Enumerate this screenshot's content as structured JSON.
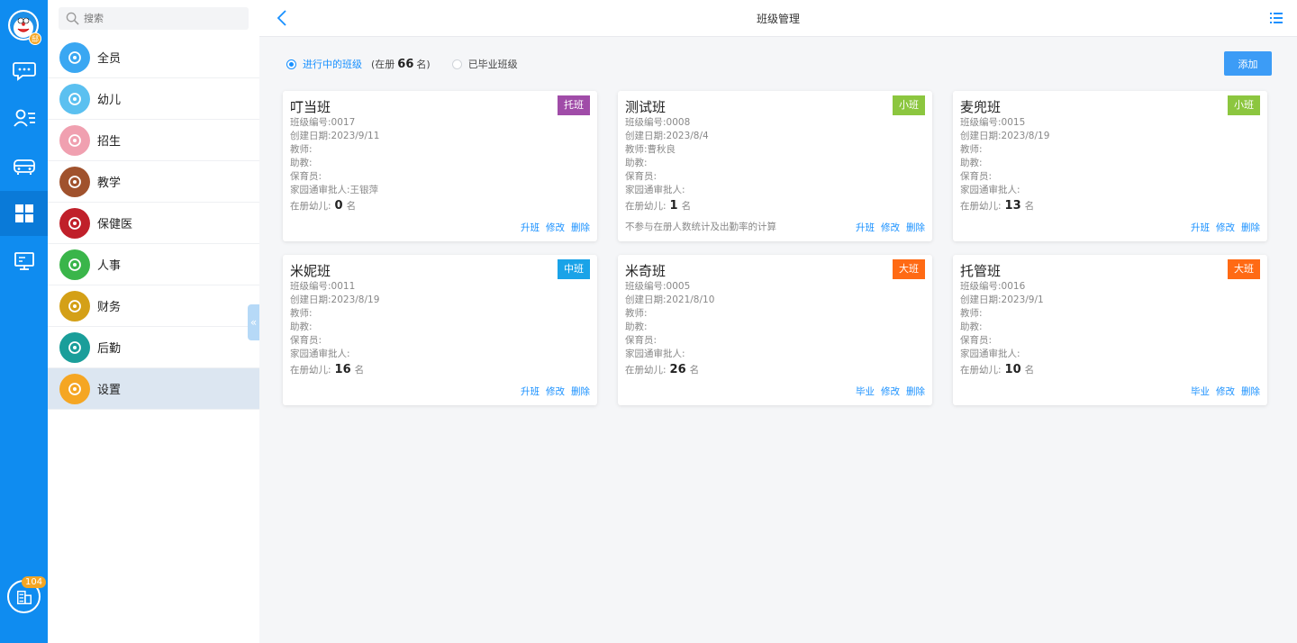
{
  "rail": {
    "avatar_badge": "邸",
    "bottom_badge": "104",
    "icons": [
      "chat-icon",
      "contacts-icon",
      "bus-icon",
      "grid-icon",
      "monitor-icon"
    ]
  },
  "search": {
    "placeholder": "搜索"
  },
  "menu": [
    {
      "label": "全员",
      "icon": "atom-icon",
      "color": "#3aa7f2"
    },
    {
      "label": "幼儿",
      "icon": "smile-icon",
      "color": "#5bc0f0"
    },
    {
      "label": "招生",
      "icon": "id-card-icon",
      "color": "#f0a0b0"
    },
    {
      "label": "教学",
      "icon": "teacher-icon",
      "color": "#a0522d"
    },
    {
      "label": "保健医",
      "icon": "heart-plus-icon",
      "color": "#c0202a"
    },
    {
      "label": "人事",
      "icon": "hr-icon",
      "color": "#3ab54a"
    },
    {
      "label": "财务",
      "icon": "abacus-icon",
      "color": "#d4a017"
    },
    {
      "label": "后勤",
      "icon": "worker-icon",
      "color": "#1a9e9a"
    },
    {
      "label": "设置",
      "icon": "settings-doc-icon",
      "color": "#f5a623"
    }
  ],
  "topbar": {
    "title": "班级管理"
  },
  "filters": {
    "active_label": "进行中的班级",
    "count_prefix": "(在册",
    "count": "66",
    "count_suffix": "名)",
    "graduated_label": "已毕业班级"
  },
  "add_button": "添加",
  "field_labels": {
    "code": "班级编号:",
    "date": "创建日期:",
    "teacher": "教师:",
    "assistant": "助教:",
    "nurse": "保育员:",
    "approver": "家园通审批人:",
    "enrolled": "在册幼儿:",
    "unit": "名"
  },
  "colors": {
    "托班": "#a04ca8",
    "小班": "#8cc63f",
    "中班": "#1aa3e8",
    "大班": "#ff6a14"
  },
  "cards": [
    {
      "name": "叮当班",
      "tag": "托班",
      "code": "0017",
      "date": "2023/9/11",
      "teacher": "",
      "assistant": "",
      "nurse": "",
      "approver": "王银萍",
      "enrolled": "0",
      "note": "",
      "actions": [
        "升班",
        "修改",
        "删除"
      ]
    },
    {
      "name": "测试班",
      "tag": "小班",
      "code": "0008",
      "date": "2023/8/4",
      "teacher": "曹秋良",
      "assistant": "",
      "nurse": "",
      "approver": "",
      "enrolled": "1",
      "note": "不参与在册人数统计及出勤率的计算",
      "actions": [
        "升班",
        "修改",
        "删除"
      ]
    },
    {
      "name": "麦兜班",
      "tag": "小班",
      "code": "0015",
      "date": "2023/8/19",
      "teacher": "",
      "assistant": "",
      "nurse": "",
      "approver": "",
      "enrolled": "13",
      "note": "",
      "actions": [
        "升班",
        "修改",
        "删除"
      ]
    },
    {
      "name": "米妮班",
      "tag": "中班",
      "code": "0011",
      "date": "2023/8/19",
      "teacher": "",
      "assistant": "",
      "nurse": "",
      "approver": "",
      "enrolled": "16",
      "note": "",
      "actions": [
        "升班",
        "修改",
        "删除"
      ]
    },
    {
      "name": "米奇班",
      "tag": "大班",
      "code": "0005",
      "date": "2021/8/10",
      "teacher": "",
      "assistant": "",
      "nurse": "",
      "approver": "",
      "enrolled": "26",
      "note": "",
      "actions": [
        "毕业",
        "修改",
        "删除"
      ]
    },
    {
      "name": "托管班",
      "tag": "大班",
      "code": "0016",
      "date": "2023/9/1",
      "teacher": "",
      "assistant": "",
      "nurse": "",
      "approver": "",
      "enrolled": "10",
      "note": "",
      "actions": [
        "毕业",
        "修改",
        "删除"
      ]
    }
  ]
}
